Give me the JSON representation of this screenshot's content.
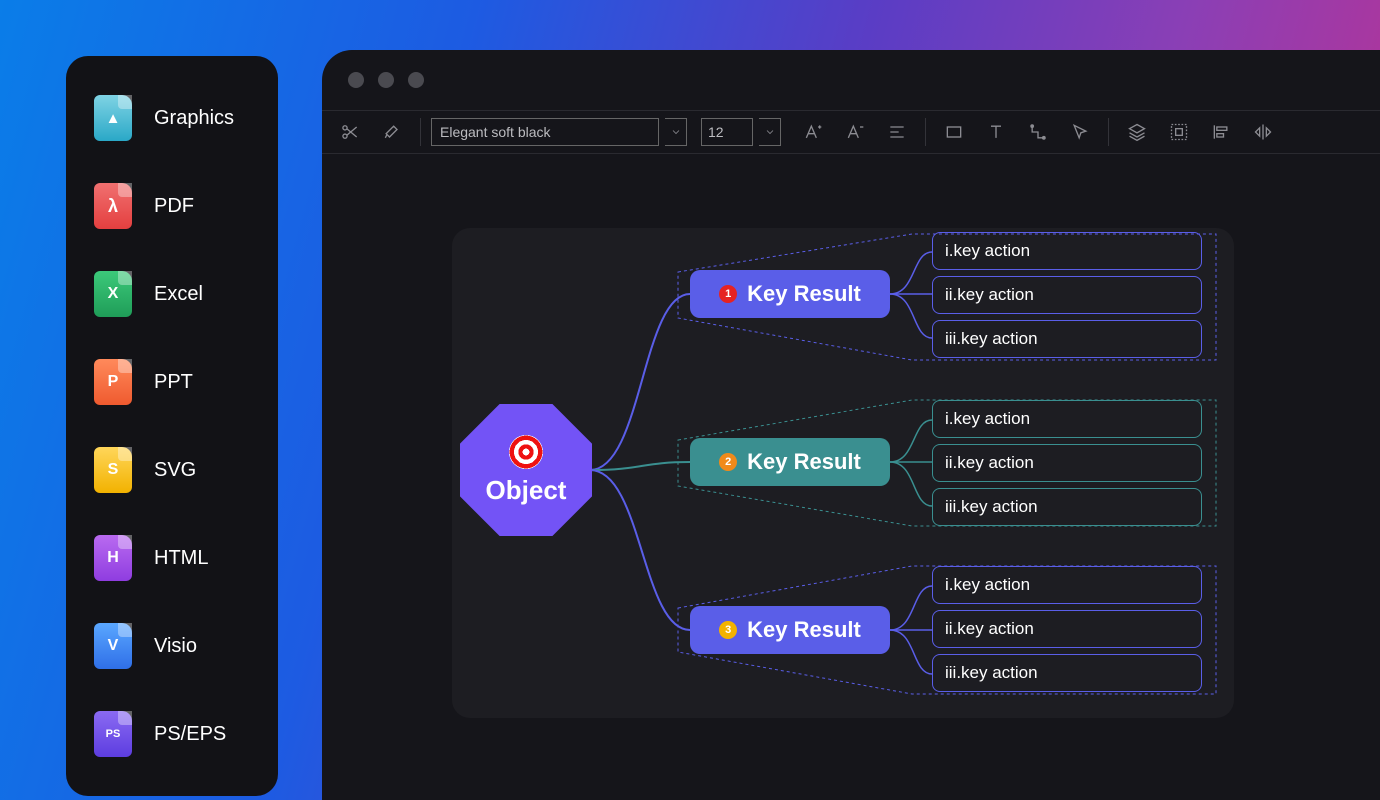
{
  "sidebar": {
    "items": [
      {
        "label": "Graphics",
        "icon": "image-icon"
      },
      {
        "label": "PDF",
        "icon": "pdf-icon"
      },
      {
        "label": "Excel",
        "icon": "excel-icon"
      },
      {
        "label": "PPT",
        "icon": "ppt-icon"
      },
      {
        "label": "SVG",
        "icon": "svg-icon"
      },
      {
        "label": "HTML",
        "icon": "html-icon"
      },
      {
        "label": "Visio",
        "icon": "visio-icon"
      },
      {
        "label": "PS/EPS",
        "icon": "ps-icon"
      }
    ]
  },
  "toolbar": {
    "theme": "Elegant soft black",
    "font_size": "12"
  },
  "mindmap": {
    "root": {
      "label": "Object"
    },
    "branches": [
      {
        "badge": "1",
        "label": "Key Result",
        "color": "#5a5ee8",
        "actions": [
          "i.key action",
          "ii.key action",
          "iii.key action"
        ]
      },
      {
        "badge": "2",
        "label": "Key Result",
        "color": "#3a8f90",
        "actions": [
          "i.key action",
          "ii.key action",
          "iii.key action"
        ]
      },
      {
        "badge": "3",
        "label": "Key Result",
        "color": "#5a5ee8",
        "actions": [
          "i.key action",
          "ii.key action",
          "iii.key action"
        ]
      }
    ]
  }
}
